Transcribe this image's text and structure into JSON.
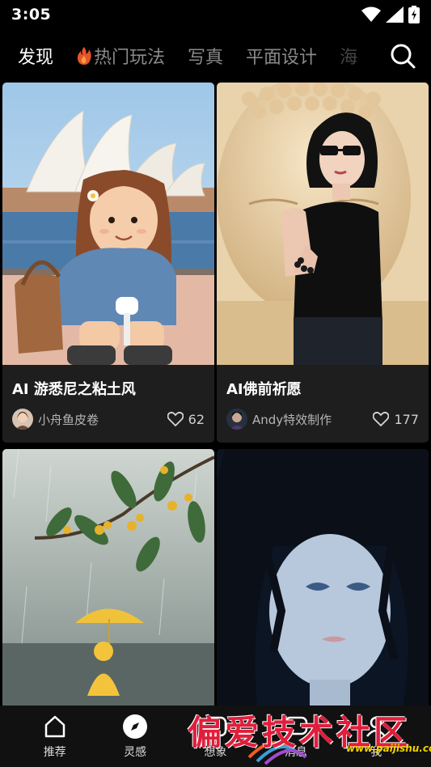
{
  "status_bar": {
    "time": "3:05"
  },
  "top_tabs": {
    "items": [
      {
        "label": "发现",
        "active": true
      },
      {
        "label": "热门玩法",
        "icon": "fire-icon"
      },
      {
        "label": "写真"
      },
      {
        "label": "平面设计"
      },
      {
        "label": "海"
      }
    ]
  },
  "cards": [
    {
      "title": "AI 游悉尼之粘土风",
      "author": "小舟鱼皮卷",
      "likes": "62"
    },
    {
      "title": "AI佛前祈愿",
      "author": "Andy特效制作",
      "likes": "177"
    },
    {
      "title": "",
      "author": "",
      "likes": ""
    },
    {
      "title": "",
      "author": "",
      "likes": ""
    }
  ],
  "bottom_nav": {
    "items": [
      {
        "label": "推荐",
        "icon": "home-icon"
      },
      {
        "label": "灵感",
        "icon": "compass-icon"
      },
      {
        "label": "想象",
        "icon": "create-icon"
      },
      {
        "label": "消息",
        "icon": "message-icon"
      },
      {
        "label": "我",
        "icon": "profile-icon"
      }
    ]
  },
  "watermark": {
    "text": "偏爱技术社区",
    "url": "www.paijishu.com"
  }
}
